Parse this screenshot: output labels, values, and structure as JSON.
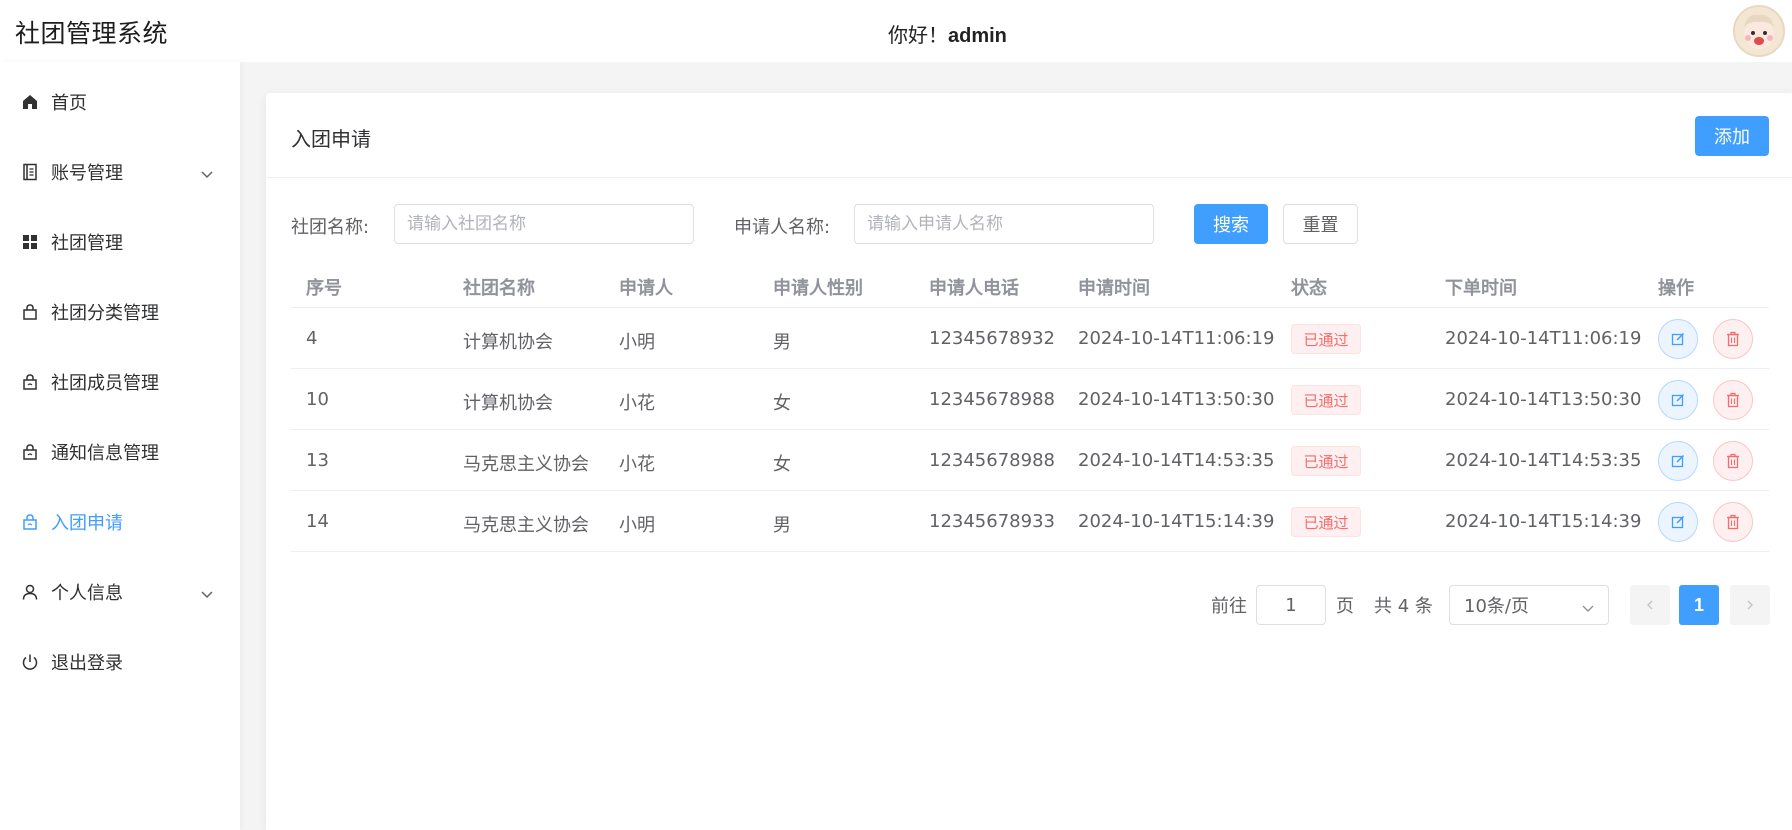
{
  "app": {
    "title": "社团管理系统",
    "greeting_prefix": "你好！",
    "username": "admin"
  },
  "sidebar": {
    "items": [
      {
        "label": "首页",
        "icon": "home-icon"
      },
      {
        "label": "账号管理",
        "icon": "document-icon",
        "expandable": true
      },
      {
        "label": "社团管理",
        "icon": "grid-icon"
      },
      {
        "label": "社团分类管理",
        "icon": "bag-icon"
      },
      {
        "label": "社团成员管理",
        "icon": "bag-refresh-icon"
      },
      {
        "label": "通知信息管理",
        "icon": "bag-refresh-icon"
      },
      {
        "label": "入团申请",
        "icon": "bag-refresh-icon",
        "active": true
      },
      {
        "label": "个人信息",
        "icon": "user-icon",
        "expandable": true
      },
      {
        "label": "退出登录",
        "icon": "power-icon"
      }
    ]
  },
  "page": {
    "title": "入团申请",
    "add_label": "添加"
  },
  "filters": {
    "club_label": "社团名称:",
    "club_placeholder": "请输入社团名称",
    "club_value": "",
    "applicant_label": "申请人名称:",
    "applicant_placeholder": "请输入申请人名称",
    "applicant_value": "",
    "search_label": "搜索",
    "reset_label": "重置"
  },
  "table": {
    "headers": [
      "序号",
      "社团名称",
      "申请人",
      "申请人性别",
      "申请人电话",
      "申请时间",
      "状态",
      "下单时间",
      "操作"
    ],
    "rows": [
      {
        "id": "4",
        "club": "计算机协会",
        "applicant": "小明",
        "gender": "男",
        "phone": "12345678932",
        "apply_time": "2024-10-14T11:06:19",
        "status": "已通过",
        "order_time": "2024-10-14T11:06:19"
      },
      {
        "id": "10",
        "club": "计算机协会",
        "applicant": "小花",
        "gender": "女",
        "phone": "12345678988",
        "apply_time": "2024-10-14T13:50:30",
        "status": "已通过",
        "order_time": "2024-10-14T13:50:30"
      },
      {
        "id": "13",
        "club": "马克思主义协会",
        "applicant": "小花",
        "gender": "女",
        "phone": "12345678988",
        "apply_time": "2024-10-14T14:53:35",
        "status": "已通过",
        "order_time": "2024-10-14T14:53:35"
      },
      {
        "id": "14",
        "club": "马克思主义协会",
        "applicant": "小明",
        "gender": "男",
        "phone": "12345678933",
        "apply_time": "2024-10-14T15:14:39",
        "status": "已通过",
        "order_time": "2024-10-14T15:14:39"
      }
    ]
  },
  "pagination": {
    "goto_prefix": "前往",
    "goto_value": "1",
    "goto_suffix": "页",
    "total_text": "共 4 条",
    "page_size": "10条/页",
    "current_page": "1"
  },
  "colors": {
    "primary": "#409eff",
    "danger": "#f56c6c",
    "text": "#303133",
    "muted": "#909399"
  }
}
